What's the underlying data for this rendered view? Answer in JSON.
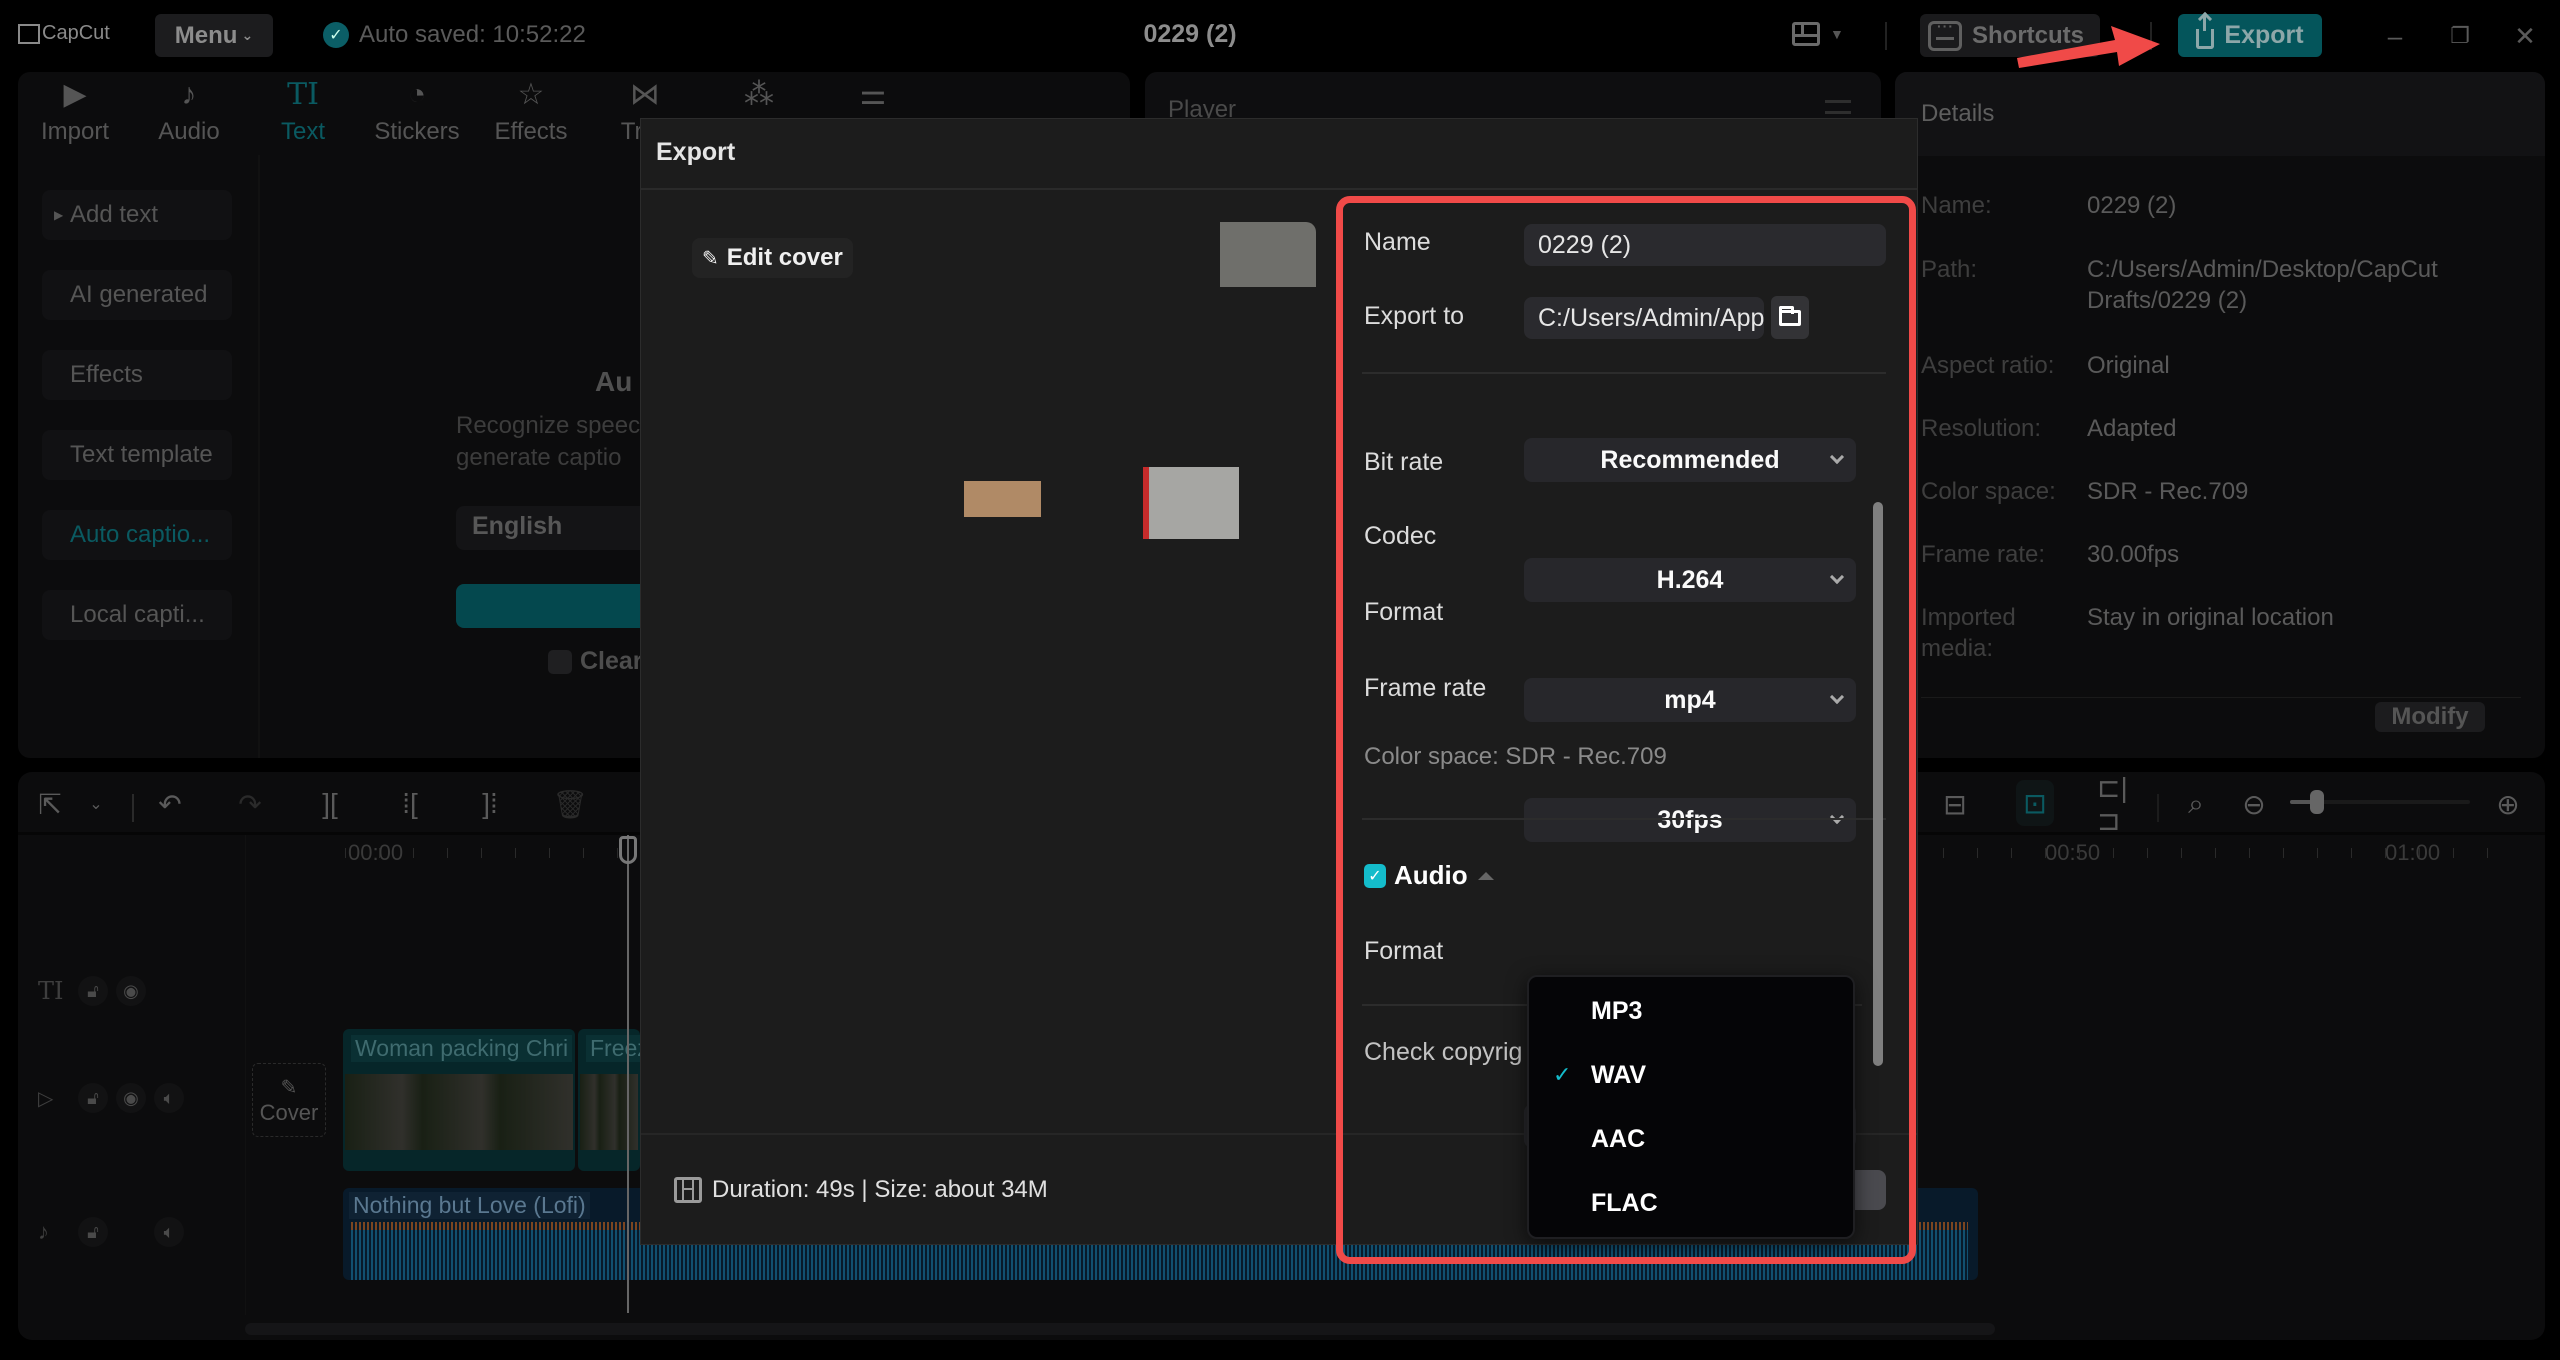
{
  "app": {
    "logo_text": "CapCut",
    "menu_label": "Menu",
    "autosave_text": "Auto saved: 10:52:22",
    "project_title": "0229 (2)",
    "shortcuts_label": "Shortcuts",
    "export_label": "Export",
    "accent_color": "#04555b",
    "annotation_color": "#f04a48"
  },
  "toolbar": {
    "tabs": [
      {
        "label": "Import",
        "icon": "import-icon",
        "glyph": "▶"
      },
      {
        "label": "Audio",
        "icon": "audio-icon",
        "glyph": "♪"
      },
      {
        "label": "Text",
        "icon": "text-icon",
        "glyph": "TI",
        "active": true
      },
      {
        "label": "Stickers",
        "icon": "sticker-icon",
        "glyph": "◔"
      },
      {
        "label": "Effects",
        "icon": "effects-icon",
        "glyph": "☆"
      },
      {
        "label": "Tran",
        "icon": "transitions-icon",
        "glyph": "⋈"
      },
      {
        "label": "",
        "icon": "filters-icon",
        "glyph": "⁂"
      },
      {
        "label": "",
        "icon": "adjustment-icon",
        "glyph": "⚌"
      }
    ]
  },
  "text_sidebar": {
    "items": [
      {
        "label": "Add text",
        "expandable": true
      },
      {
        "label": "AI generated"
      },
      {
        "label": "Effects"
      },
      {
        "label": "Text template"
      },
      {
        "label": "Auto captio...",
        "active": true
      },
      {
        "label": "Local capti..."
      }
    ]
  },
  "auto_captions": {
    "title": "Au",
    "description_line1": "Recognize speec",
    "description_line2": "generate captio",
    "language": "English",
    "clear_label": "Clear"
  },
  "player": {
    "title": "Player"
  },
  "details": {
    "title": "Details",
    "rows": [
      {
        "key": "Name:",
        "value": "0229 (2)"
      },
      {
        "key": "Path:",
        "value": "C:/Users/Admin/Desktop/CapCut Drafts/0229 (2)"
      },
      {
        "key": "Aspect ratio:",
        "value": "Original"
      },
      {
        "key": "Resolution:",
        "value": "Adapted"
      },
      {
        "key": "Color space:",
        "value": "SDR - Rec.709"
      },
      {
        "key": "Frame rate:",
        "value": "30.00fps"
      },
      {
        "key": "Imported media:",
        "value": "Stay in original location"
      }
    ],
    "modify_label": "Modify"
  },
  "timeline": {
    "ruler": [
      "00:00",
      "00:50",
      "01:00"
    ],
    "cover_label": "Cover",
    "clips": [
      {
        "label": "Woman packing Chri"
      },
      {
        "label": "Freez"
      }
    ],
    "audio_clip": "Nothing but Love (Lofi)",
    "zoom_level": 0.15
  },
  "export_dialog": {
    "title": "Export",
    "edit_cover_label": "Edit cover",
    "name_label": "Name",
    "name_value": "0229 (2)",
    "export_to_label": "Export to",
    "export_to_value": "C:/Users/Admin/App...",
    "bit_rate_label": "Bit rate",
    "bit_rate_value": "Recommended",
    "codec_label": "Codec",
    "codec_value": "H.264",
    "format_label": "Format",
    "format_value": "mp4",
    "frame_rate_label": "Frame rate",
    "frame_rate_value": "30fps",
    "color_space_note": "Color space: SDR - Rec.709",
    "audio_label": "Audio",
    "audio_checked": true,
    "audio_format_label": "Format",
    "audio_format_value": "WAV",
    "audio_format_options": [
      {
        "label": "MP3",
        "selected": false
      },
      {
        "label": "WAV",
        "selected": true
      },
      {
        "label": "AAC",
        "selected": false
      },
      {
        "label": "FLAC",
        "selected": false
      }
    ],
    "copyright_label": "Check copyrig",
    "footer_info": "Duration: 49s | Size: about 34M"
  }
}
